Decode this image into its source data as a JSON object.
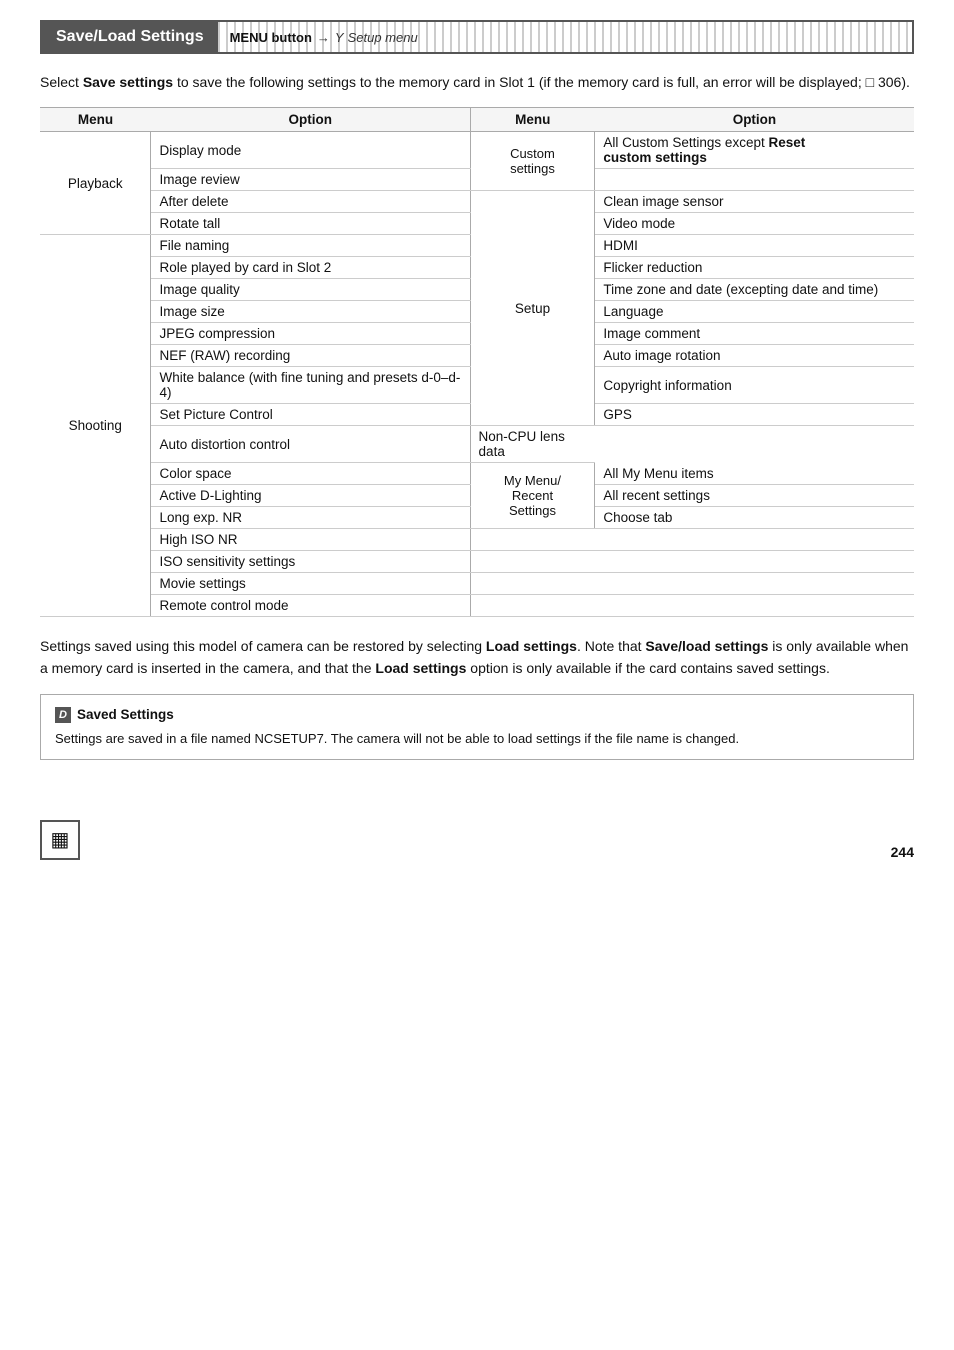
{
  "header": {
    "title": "Save/Load Settings",
    "path_menu": "MENU button",
    "path_arrow": "→",
    "path_icon": "Y",
    "path_label": "Setup menu"
  },
  "intro": {
    "text_before": "Select ",
    "save_bold": "Save settings",
    "text_after": " to save the following settings to the memory card in Slot 1 (if the memory card is full, an error will be displayed; ",
    "ref": "□ 306",
    "text_end": ")."
  },
  "table": {
    "col1_header_menu": "Menu",
    "col1_header_option": "Option",
    "col2_header_menu": "Menu",
    "col2_header_option": "Option",
    "left_rows": [
      {
        "menu": "Playback",
        "menu_rowspan": 4,
        "option": "Display mode"
      },
      {
        "menu": "",
        "option": "Image review"
      },
      {
        "menu": "",
        "option": "After delete"
      },
      {
        "menu": "",
        "option": "Rotate tall"
      },
      {
        "menu": "Shooting",
        "menu_rowspan": 17,
        "option": "File naming"
      },
      {
        "menu": "",
        "option": "Role played by card in Slot 2"
      },
      {
        "menu": "",
        "option": "Image quality"
      },
      {
        "menu": "",
        "option": "Image size"
      },
      {
        "menu": "",
        "option": "JPEG compression"
      },
      {
        "menu": "",
        "option": "NEF (RAW) recording"
      },
      {
        "menu": "",
        "option": "White balance (with fine tuning and presets d-0–d-4)"
      },
      {
        "menu": "",
        "option": "Set Picture Control"
      },
      {
        "menu": "",
        "option": "Auto distortion control"
      },
      {
        "menu": "",
        "option": "Color space"
      },
      {
        "menu": "",
        "option": "Active D-Lighting"
      },
      {
        "menu": "",
        "option": "Long exp. NR"
      },
      {
        "menu": "",
        "option": "High ISO NR"
      },
      {
        "menu": "",
        "option": "ISO sensitivity settings"
      },
      {
        "menu": "",
        "option": "Movie settings"
      },
      {
        "menu": "",
        "option": "Remote control mode"
      }
    ],
    "right_rows": [
      {
        "menu": "Custom settings",
        "menu_rowspan": 2,
        "option": "All Custom Settings except ",
        "option_bold": "Reset custom settings",
        "bold_inline": true
      },
      {
        "menu": "",
        "option": ""
      },
      {
        "menu": "Setup",
        "menu_rowspan": 12,
        "option": "Clean image sensor"
      },
      {
        "menu": "",
        "option": "Video mode"
      },
      {
        "menu": "",
        "option": "HDMI"
      },
      {
        "menu": "",
        "option": "Flicker reduction"
      },
      {
        "menu": "",
        "option": "Time zone and date (excepting date and time)"
      },
      {
        "menu": "",
        "option": "Language"
      },
      {
        "menu": "",
        "option": "Image comment"
      },
      {
        "menu": "",
        "option": "Auto image rotation"
      },
      {
        "menu": "",
        "option": "Copyright information"
      },
      {
        "menu": "",
        "option": "GPS"
      },
      {
        "menu": "",
        "option": "Non-CPU lens data"
      },
      {
        "menu": "",
        "option": ""
      },
      {
        "menu": "My Menu/ Recent Settings",
        "menu_rowspan": 3,
        "option": "All My Menu items"
      },
      {
        "menu": "",
        "option": "All recent settings"
      },
      {
        "menu": "",
        "option": "Choose tab"
      }
    ]
  },
  "footer_text": {
    "p1_before": "Settings saved using this model of camera can be restored by selecting ",
    "p1_bold1": "Load settings",
    "p1_middle": ".  Note that ",
    "p1_bold2": "Save/load settings",
    "p1_after": " is only available when a memory card is inserted in the camera, and that the ",
    "p1_bold3": "Load settings",
    "p1_end": " option is only available if the card contains saved settings."
  },
  "note": {
    "icon": "D",
    "title": "Saved Settings",
    "body": "Settings are saved in a file named NCSETUP7.  The camera will not be able to load settings if the file name is changed."
  },
  "page": {
    "number": "244",
    "icon_symbol": "▦"
  }
}
